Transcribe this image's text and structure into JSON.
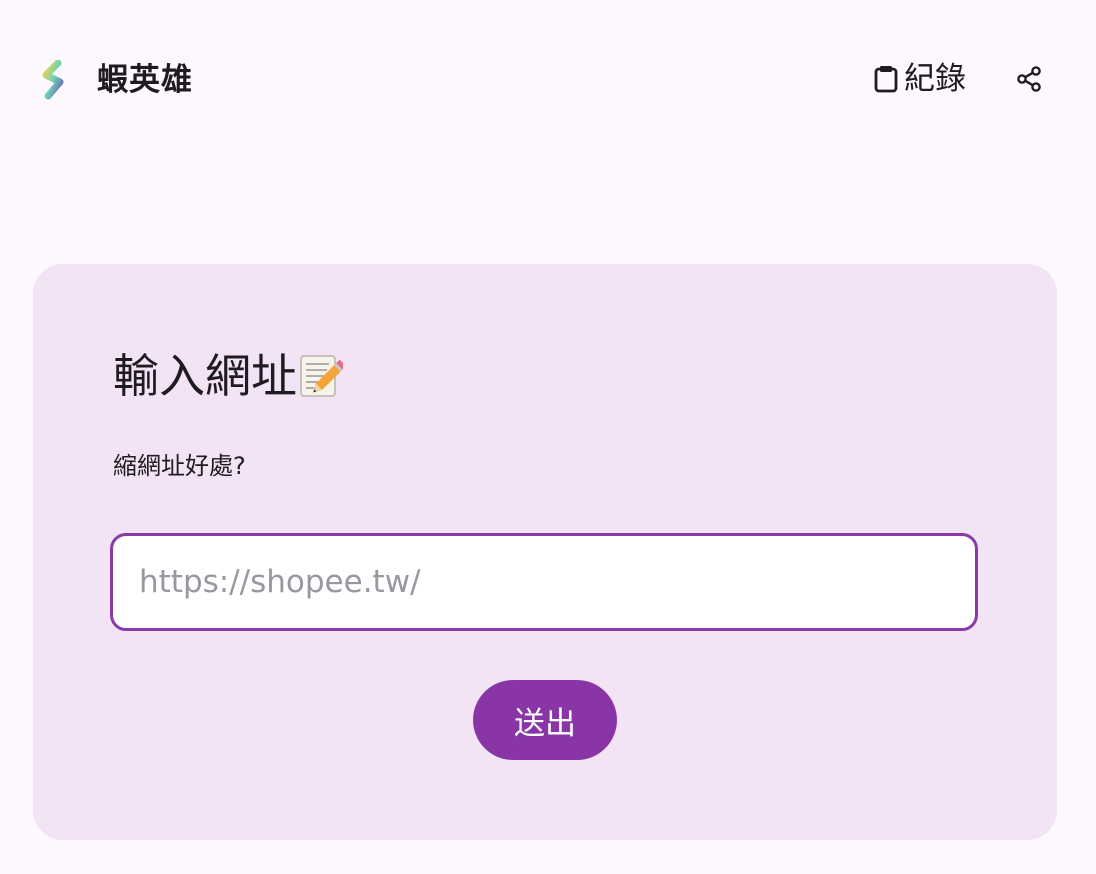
{
  "header": {
    "logo_icon": "s-bolt-logo",
    "app_title": "蝦英雄",
    "history_icon": "clipboard-icon",
    "history_label": "紀錄",
    "share_icon": "share-icon"
  },
  "card": {
    "title": "輸入網址",
    "title_emoji": "memo-icon",
    "subtitle": "縮網址好處?",
    "input": {
      "value": "",
      "placeholder": "https://shopee.tw/"
    },
    "submit_label": "送出"
  },
  "colors": {
    "page_background": "#fcf8fd",
    "card_background": "#f3e4f5",
    "accent": "#8a35a6",
    "input_border": "#8a3aa7",
    "placeholder": "#9a97a0"
  }
}
